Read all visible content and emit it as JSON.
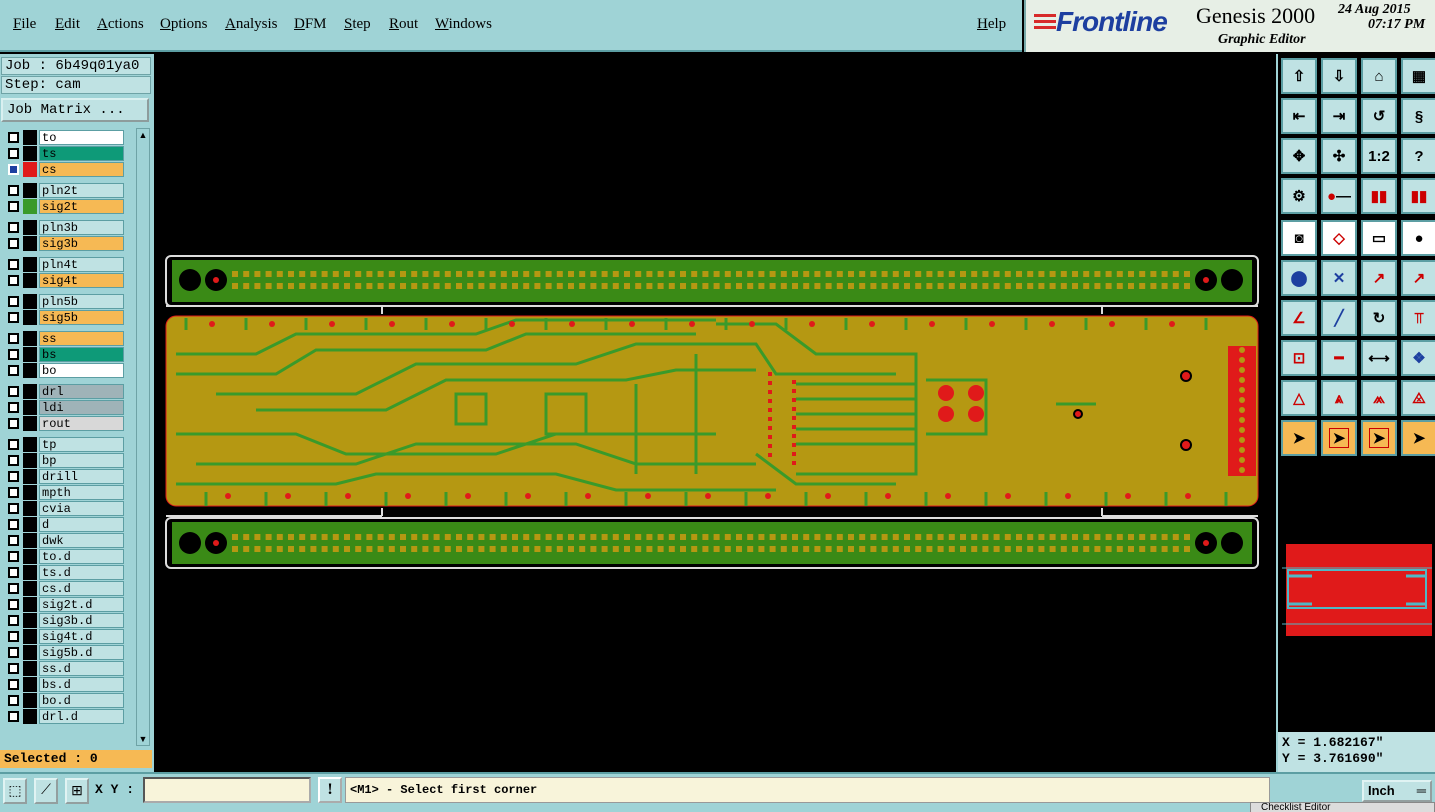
{
  "menu": {
    "items": [
      "File",
      "Edit",
      "Actions",
      "Options",
      "Analysis",
      "DFM",
      "Step",
      "Rout",
      "Windows"
    ],
    "help": "Help"
  },
  "brand": {
    "logo": "Frontline",
    "product": "Genesis 2000",
    "subtitle": "Graphic Editor",
    "date": "24 Aug 2015",
    "time": "07:17 PM"
  },
  "job": {
    "job_label": "Job : 6b49q01ya0",
    "step_label": "Step: cam",
    "matrix_button": "Job Matrix ..."
  },
  "layers": [
    {
      "name": "to",
      "color": "#ffffff",
      "swatch": "#000000"
    },
    {
      "name": "ts",
      "color": "#0e9a78",
      "swatch": "#000000"
    },
    {
      "name": "cs",
      "color": "#f6b954",
      "swatch": "#e01a1a",
      "active": true
    },
    {
      "name": "pln2t",
      "color": "#bfe2e3",
      "swatch": "#000000"
    },
    {
      "name": "sig2t",
      "color": "#f6b954",
      "swatch": "#3a9a2a"
    },
    {
      "name": "pln3b",
      "color": "#bfe2e3",
      "swatch": "#000000"
    },
    {
      "name": "sig3b",
      "color": "#f6b954",
      "swatch": "#000000"
    },
    {
      "name": "pln4t",
      "color": "#bfe2e3",
      "swatch": "#000000"
    },
    {
      "name": "sig4t",
      "color": "#f6b954",
      "swatch": "#000000"
    },
    {
      "name": "pln5b",
      "color": "#bfe2e3",
      "swatch": "#000000"
    },
    {
      "name": "sig5b",
      "color": "#f6b954",
      "swatch": "#000000"
    },
    {
      "name": "ss",
      "color": "#f6b954",
      "swatch": "#000000"
    },
    {
      "name": "bs",
      "color": "#0e9a78",
      "swatch": "#000000"
    },
    {
      "name": "bo",
      "color": "#ffffff",
      "swatch": "#000000"
    },
    {
      "name": "drl",
      "color": "#9fb3b8",
      "swatch": "#000000"
    },
    {
      "name": "ldi",
      "color": "#9fb3b8",
      "swatch": "#000000"
    },
    {
      "name": "rout",
      "color": "#d8d8d8",
      "swatch": "#000000"
    },
    {
      "name": "tp",
      "color": "#bfe2e3",
      "swatch": "#000000"
    },
    {
      "name": "bp",
      "color": "#bfe2e3",
      "swatch": "#000000"
    },
    {
      "name": "drill",
      "color": "#bfe2e3",
      "swatch": "#000000"
    },
    {
      "name": "mpth",
      "color": "#bfe2e3",
      "swatch": "#000000"
    },
    {
      "name": "cvia",
      "color": "#bfe2e3",
      "swatch": "#000000"
    },
    {
      "name": "d",
      "color": "#bfe2e3",
      "swatch": "#000000"
    },
    {
      "name": "dwk",
      "color": "#bfe2e3",
      "swatch": "#000000"
    },
    {
      "name": "to.d",
      "color": "#bfe2e3",
      "swatch": "#000000"
    },
    {
      "name": "ts.d",
      "color": "#bfe2e3",
      "swatch": "#000000"
    },
    {
      "name": "cs.d",
      "color": "#bfe2e3",
      "swatch": "#000000"
    },
    {
      "name": "sig2t.d",
      "color": "#bfe2e3",
      "swatch": "#000000"
    },
    {
      "name": "sig3b.d",
      "color": "#bfe2e3",
      "swatch": "#000000"
    },
    {
      "name": "sig4t.d",
      "color": "#bfe2e3",
      "swatch": "#000000"
    },
    {
      "name": "sig5b.d",
      "color": "#bfe2e3",
      "swatch": "#000000"
    },
    {
      "name": "ss.d",
      "color": "#bfe2e3",
      "swatch": "#000000"
    },
    {
      "name": "bs.d",
      "color": "#bfe2e3",
      "swatch": "#000000"
    },
    {
      "name": "bo.d",
      "color": "#bfe2e3",
      "swatch": "#000000"
    },
    {
      "name": "drl.d",
      "color": "#bfe2e3",
      "swatch": "#000000"
    }
  ],
  "status": {
    "selected": "Selected : 0",
    "x": "X = 1.682167\"",
    "y": "Y = 3.761690\""
  },
  "toolbar": {
    "one_to_two": "1:2",
    "help_icon": "?"
  },
  "bottom": {
    "xy_label": "X Y :",
    "xy_value": "",
    "alert": "!",
    "prompt": "<M1> - Select first corner",
    "unit": "Inch",
    "task_peek": "Checklist Editor"
  },
  "colors": {
    "panel": "#9fd3d6",
    "copper": "#b59812",
    "trace": "#3a9a2a",
    "pad": "#e01a1a"
  }
}
